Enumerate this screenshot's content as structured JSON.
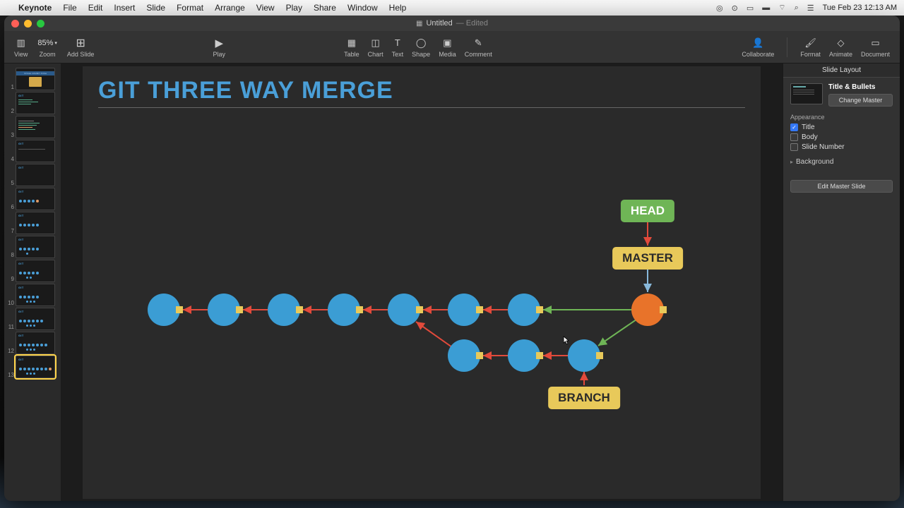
{
  "menubar": {
    "app": "Keynote",
    "items": [
      "File",
      "Edit",
      "Insert",
      "Slide",
      "Format",
      "Arrange",
      "View",
      "Play",
      "Share",
      "Window",
      "Help"
    ],
    "clock": "Tue Feb 23  12:13 AM"
  },
  "window": {
    "title": "Untitled",
    "edited": "Edited"
  },
  "toolbar": {
    "view": "View",
    "zoom": "Zoom",
    "zoom_value": "85%",
    "add_slide": "Add Slide",
    "play": "Play",
    "table": "Table",
    "chart": "Chart",
    "text": "Text",
    "shape": "Shape",
    "media": "Media",
    "comment": "Comment",
    "collaborate": "Collaborate",
    "format": "Format",
    "animate": "Animate",
    "document": "Document"
  },
  "nav": {
    "count": 13,
    "selected": 13
  },
  "slide": {
    "title": "GIT THREE WAY MERGE",
    "tags": {
      "head": "HEAD",
      "master": "MASTER",
      "branch": "BRANCH"
    },
    "nodes_main_count": 7,
    "nodes_branch_count": 3,
    "merge_node_color": "orange"
  },
  "inspector": {
    "tab": "Slide Layout",
    "layout_name": "Title & Bullets",
    "change_master": "Change Master",
    "appearance": "Appearance",
    "title_chk": "Title",
    "body_chk": "Body",
    "slidenum_chk": "Slide Number",
    "background": "Background",
    "edit_master": "Edit Master Slide"
  },
  "colors": {
    "node": "#3b9dd4",
    "merge": "#e8732a",
    "head": "#6fb556",
    "tag": "#e8c95a",
    "arrow_red": "#e24a3b",
    "arrow_green": "#6fb556"
  }
}
